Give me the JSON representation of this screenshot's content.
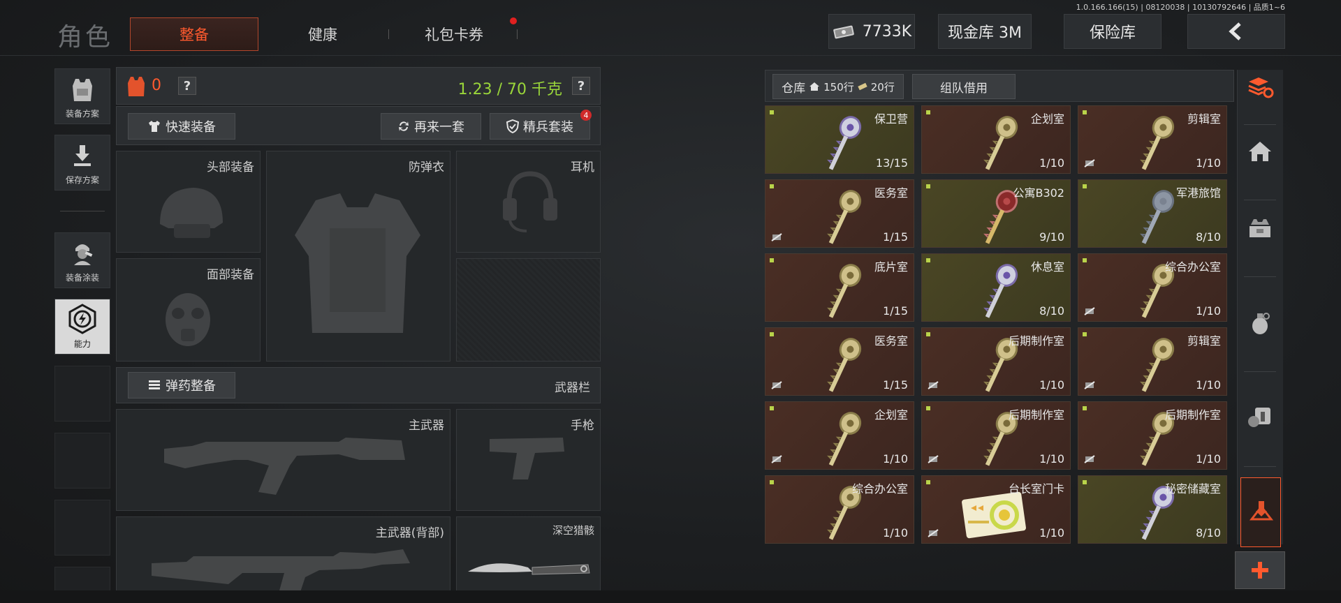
{
  "version_text": "1.0.166.166(15) | 08120038 | 10130792646 | 品质1~6",
  "header": {
    "title": "角色",
    "tabs": [
      {
        "label": "整备",
        "active": true
      },
      {
        "label": "健康",
        "active": false
      },
      {
        "label": "礼包卡券",
        "active": false,
        "notification": true
      }
    ],
    "currency": "7733K",
    "cash_vault": "现金库 3M",
    "insurance_vault": "保险库"
  },
  "sidebar": {
    "items": [
      {
        "label": "装备方案",
        "icon": "vest-icon"
      },
      {
        "label": "保存方案",
        "icon": "download-icon"
      },
      {
        "label": "装备涂装",
        "icon": "soldier-icon"
      },
      {
        "label": "能力",
        "icon": "ability-icon",
        "active": true
      }
    ]
  },
  "gear": {
    "armor_count": "0",
    "weight": "1.23 / 70 千克",
    "quick_equip": "快速装备",
    "again_set": "再来一套",
    "elite_set": "精兵套装",
    "elite_badge": "4",
    "slots": {
      "head": "头部装备",
      "vest": "防弹衣",
      "ear": "耳机",
      "face": "面部装备"
    },
    "ammo_equip": "弹药整备",
    "weapon_bar": "武器栏",
    "weapons": {
      "primary": "主武器",
      "pistol": "手枪",
      "primary_back": "主武器(背部)",
      "melee": "深空猎骸"
    }
  },
  "warehouse": {
    "tab_label": "仓库",
    "rows_a": "150行",
    "rows_b": "20行",
    "team_borrow": "组队借用",
    "items": [
      {
        "name": "保卫营",
        "qty": "13/15",
        "bg": "olive",
        "key": "purple",
        "noflag": false
      },
      {
        "name": "企划室",
        "qty": "1/10",
        "bg": "brown",
        "key": "gold",
        "noflag": false
      },
      {
        "name": "剪辑室",
        "qty": "1/10",
        "bg": "brown",
        "key": "gold",
        "noflag": true
      },
      {
        "name": "医务室",
        "qty": "1/15",
        "bg": "brown",
        "key": "gold",
        "noflag": true
      },
      {
        "name": "公寓B302",
        "qty": "9/10",
        "bg": "olive",
        "key": "red",
        "noflag": false
      },
      {
        "name": "军港旅馆",
        "qty": "8/10",
        "bg": "olive",
        "key": "steel",
        "noflag": false
      },
      {
        "name": "底片室",
        "qty": "1/15",
        "bg": "brown",
        "key": "gold",
        "noflag": false
      },
      {
        "name": "休息室",
        "qty": "8/10",
        "bg": "olive",
        "key": "purple",
        "noflag": false
      },
      {
        "name": "综合办公室",
        "qty": "1/10",
        "bg": "brown",
        "key": "gold",
        "noflag": true
      },
      {
        "name": "医务室",
        "qty": "1/15",
        "bg": "brown",
        "key": "gold",
        "noflag": true
      },
      {
        "name": "后期制作室",
        "qty": "1/10",
        "bg": "brown",
        "key": "gold",
        "noflag": true
      },
      {
        "name": "剪辑室",
        "qty": "1/10",
        "bg": "brown",
        "key": "gold",
        "noflag": true
      },
      {
        "name": "企划室",
        "qty": "1/10",
        "bg": "brown",
        "key": "gold",
        "noflag": true
      },
      {
        "name": "后期制作室",
        "qty": "1/10",
        "bg": "brown",
        "key": "gold",
        "noflag": true
      },
      {
        "name": "后期制作室",
        "qty": "1/10",
        "bg": "brown",
        "key": "gold",
        "noflag": true
      },
      {
        "name": "综合办公室",
        "qty": "1/10",
        "bg": "brown",
        "key": "gold",
        "noflag": false
      },
      {
        "name": "台长室门卡",
        "qty": "1/10",
        "bg": "brown",
        "key": "card",
        "noflag": true
      },
      {
        "name": "秘密储藏室",
        "qty": "8/10",
        "bg": "olive",
        "key": "purple",
        "noflag": false
      }
    ]
  },
  "colors": {
    "accent": "#ff5a2e",
    "weight_green": "#9ad63a",
    "brown_card": "#4a2e24",
    "olive_card": "#4a4624"
  },
  "rail_icons": [
    "layers-refresh-icon",
    "home-icon",
    "vest-box-icon",
    "grenade-icon",
    "medkit-icon",
    "tools-icon",
    "plus-icon"
  ]
}
